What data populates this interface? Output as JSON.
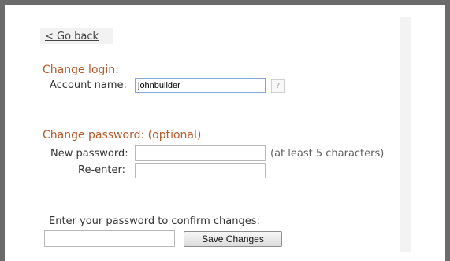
{
  "nav": {
    "back_label": "< Go back"
  },
  "login": {
    "heading": "Change login:",
    "account_label": "Account name:",
    "account_value": "johnbuilder",
    "help_label": "?"
  },
  "password": {
    "heading": "Change password: (optional)",
    "new_label": "New password:",
    "new_value": "",
    "new_hint": "(at least 5 characters)",
    "reenter_label": "Re-enter:",
    "reenter_value": ""
  },
  "confirm": {
    "prompt": "Enter your password to confirm changes:",
    "value": "",
    "save_label": "Save Changes"
  }
}
